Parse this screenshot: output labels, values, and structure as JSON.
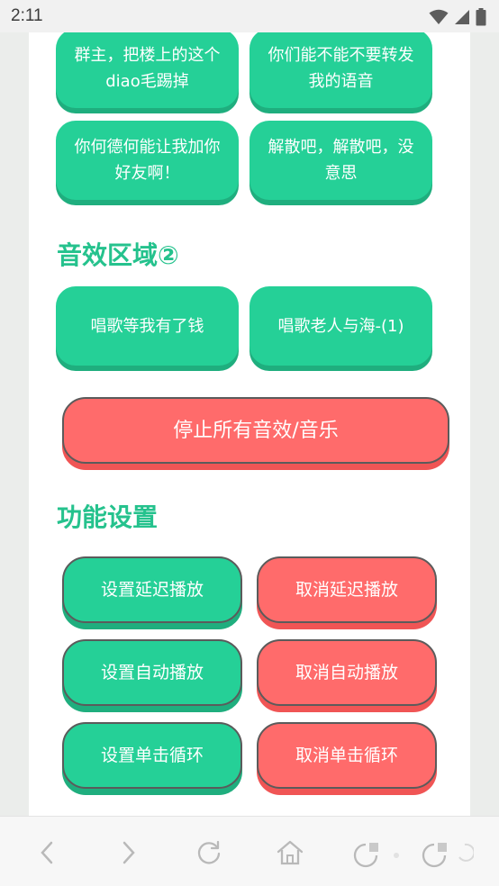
{
  "status": {
    "time": "2:11"
  },
  "quotes": [
    {
      "text": "群主，把楼上的这个diao毛踢掉"
    },
    {
      "text": "你们能不能不要转发我的语音"
    },
    {
      "text": "你何德何能让我加你好友啊！"
    },
    {
      "text": "解散吧，解散吧，没意思"
    }
  ],
  "sound_section": {
    "title": "音效区域②",
    "items": [
      {
        "text": "唱歌等我有了钱"
      },
      {
        "text": "唱歌老人与海-(1)"
      }
    ]
  },
  "stop_all_label": "停止所有音效/音乐",
  "settings": {
    "title": "功能设置",
    "set_delay": "设置延迟播放",
    "cancel_delay": "取消延迟播放",
    "set_auto": "设置自动播放",
    "cancel_auto": "取消自动播放",
    "set_loop": "设置单击循环",
    "cancel_loop": "取消单击循环"
  },
  "colors": {
    "green": "#25d097",
    "red": "#ff6b6b",
    "heading": "#25c28d"
  },
  "nav_icons": [
    "back-icon",
    "forward-icon",
    "refresh-icon",
    "home-icon",
    "tabs-icon",
    "menu-icon"
  ]
}
